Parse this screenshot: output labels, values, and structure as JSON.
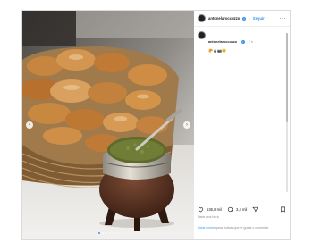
{
  "post": {
    "username": "antonelaroccuzzo",
    "separator": "•",
    "follow_label": "Seguir",
    "more_icon": "more-horizontal-icon",
    "caption": {
      "username": "antonelaroccuzzo",
      "time": "1 h",
      "emojis": "🥐🧉📷😊"
    },
    "likes": "536,6 mil",
    "comments": "3,4 mil",
    "date": "Hace una hora",
    "login_prompt": {
      "link": "Inicia sesión",
      "rest": "para indicar que te gusta o comentar."
    },
    "carousel": {
      "total_slides": 6,
      "active_index": 0
    },
    "colors": {
      "accent": "#3897f0",
      "border": "#dbdbdb",
      "muted": "#8e8e8e"
    }
  }
}
